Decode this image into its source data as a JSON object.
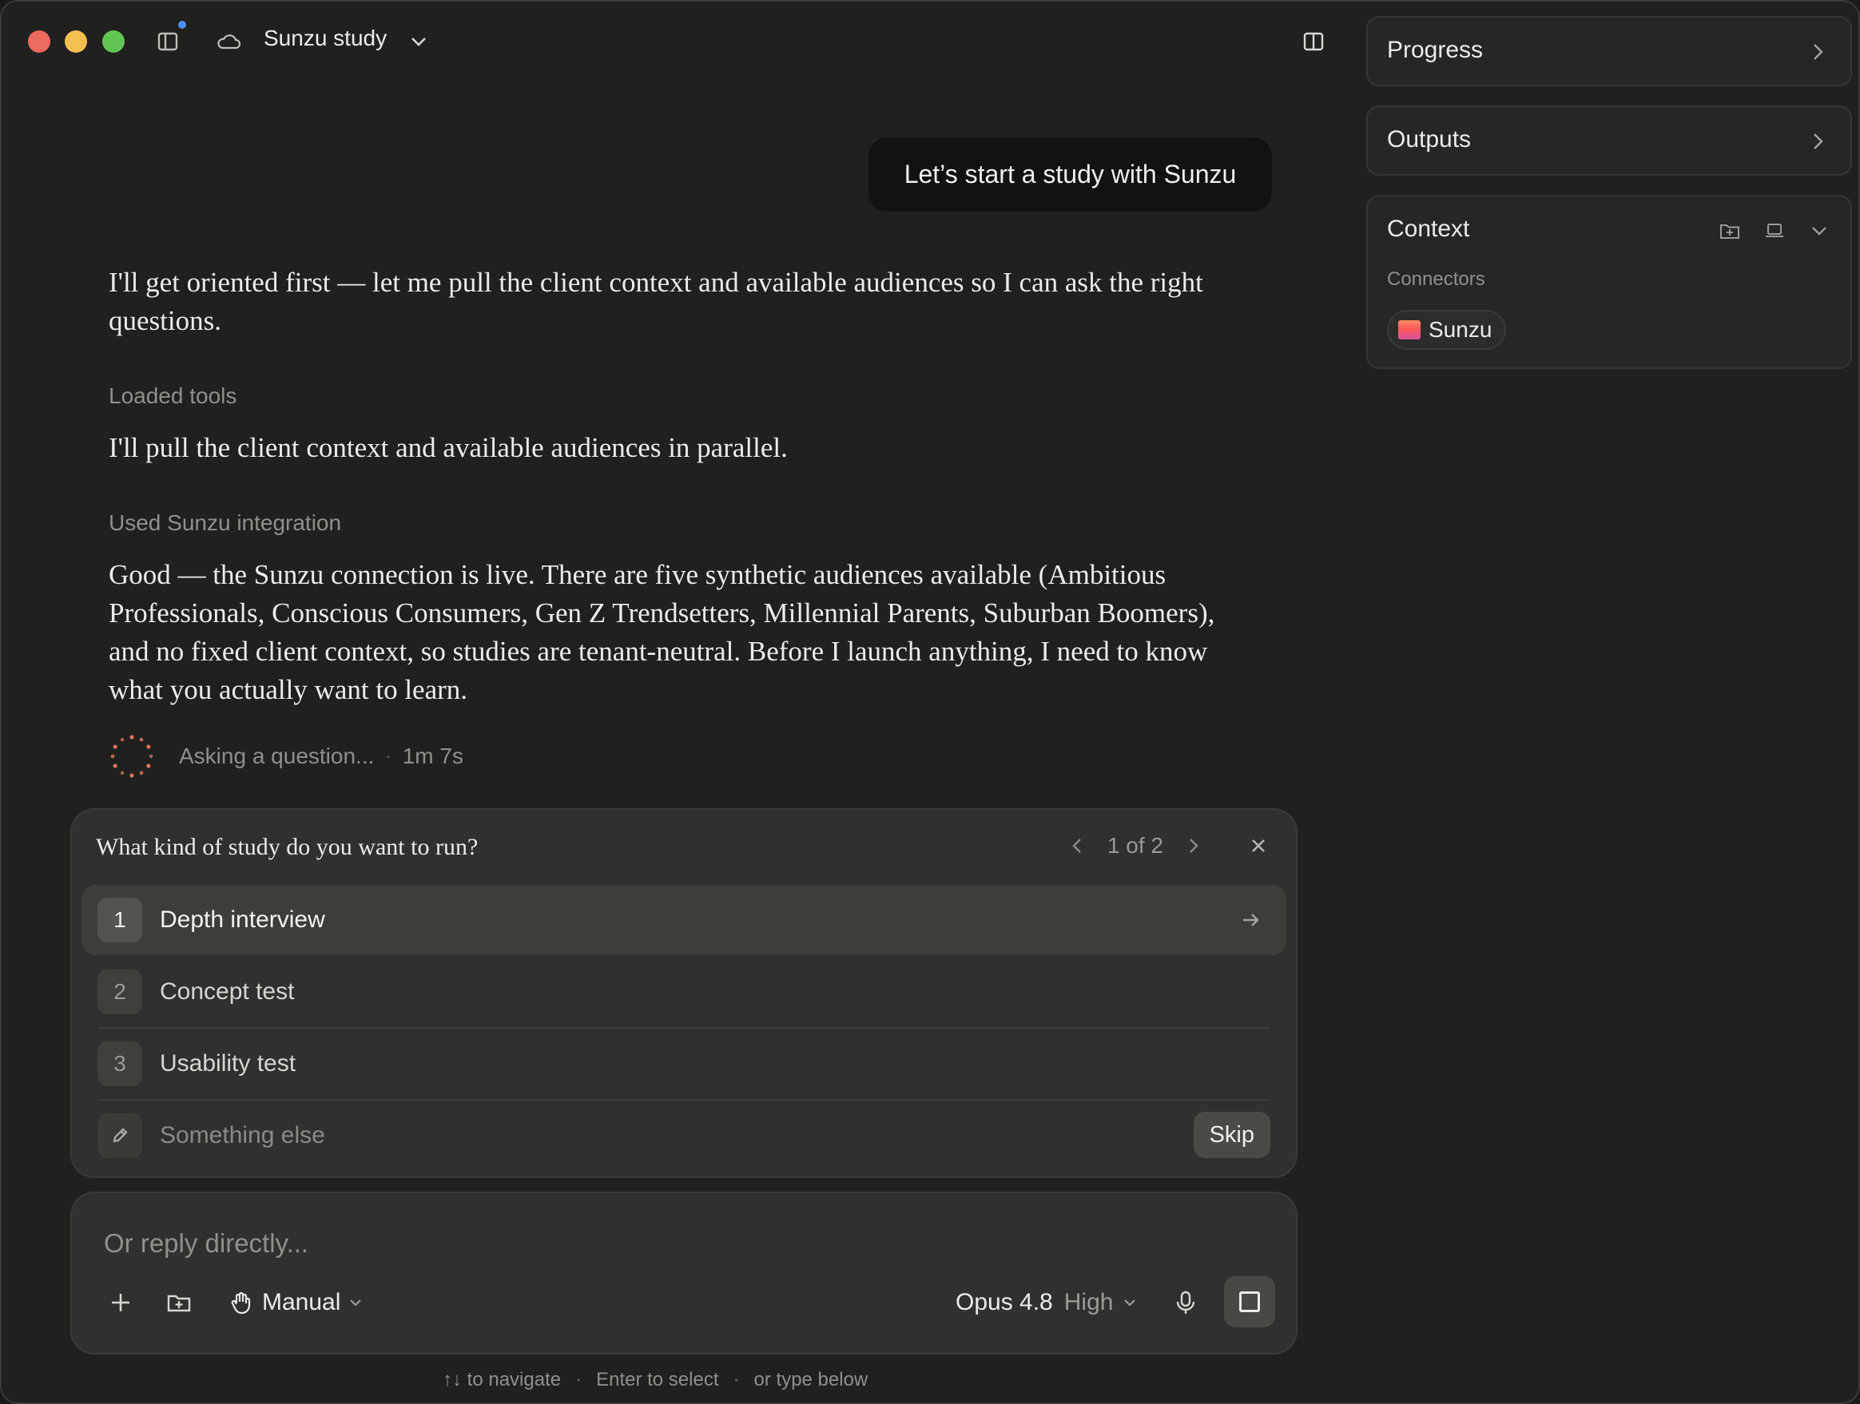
{
  "titlebar": {
    "project_title": "Sunzu study"
  },
  "chat": {
    "user_message": "Let’s start a study with Sunzu",
    "assistant_1": "I'll get oriented first — let me pull the client context and available audiences so I can ask the right questions.",
    "tool_1_label": "Loaded tools",
    "assistant_2": "I'll pull the client context and available audiences in parallel.",
    "tool_2_label": "Used Sunzu integration",
    "assistant_3": "Good — the Sunzu connection is live. There are five synthetic audiences available (Ambitious Professionals, Conscious Consumers, Gen Z Trendsetters, Millennial Parents, Suburban Boomers), and no fixed client context, so studies are tenant-neutral. Before I launch anything, I need to know what you actually want to learn.",
    "status_text": "Asking a question...",
    "status_time": "1m 7s"
  },
  "question": {
    "title": "What kind of study do you want to run?",
    "pager": "1 of 2",
    "options": [
      {
        "num": "1",
        "label": "Depth interview"
      },
      {
        "num": "2",
        "label": "Concept test"
      },
      {
        "num": "3",
        "label": "Usability test"
      }
    ],
    "other_placeholder": "Something else",
    "skip_label": "Skip"
  },
  "composer": {
    "placeholder": "Or reply directly...",
    "mode_label": "Manual",
    "model_name": "Opus 4.8",
    "effort_label": "High"
  },
  "hints": {
    "navigate": "↑↓ to navigate",
    "select": "Enter to select",
    "type": "or type below"
  },
  "right_panel": {
    "progress_title": "Progress",
    "outputs_title": "Outputs",
    "context_title": "Context",
    "connectors_label": "Connectors",
    "connector_name": "Sunzu"
  },
  "colors": {
    "background": "#20201f",
    "card": "#30302e",
    "spinner_accent": "#d97757",
    "close_light": "#ed6a5e",
    "minimize_light": "#f4bf4f",
    "zoom_light": "#61c554",
    "notification_dot": "#4f8ef7"
  },
  "icons": [
    "sidebar-toggle-icon",
    "cloud-icon",
    "chevron-down-icon",
    "panel-toggle-icon",
    "chevron-left-icon",
    "chevron-right-icon",
    "close-icon",
    "arrow-right-icon",
    "pencil-icon",
    "plus-icon",
    "folder-add-icon",
    "hand-icon",
    "microphone-icon",
    "stop-icon",
    "laptop-icon"
  ]
}
